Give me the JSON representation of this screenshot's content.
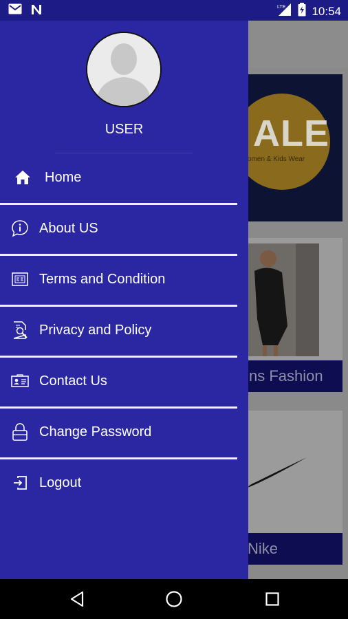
{
  "status_bar": {
    "time": "10:54",
    "network": "LTE",
    "icons": [
      "gmail-icon",
      "n-app-icon",
      "lte-signal-icon",
      "battery-icon"
    ]
  },
  "drawer": {
    "user_name": "USER",
    "background_color": "#2b27a3",
    "items": [
      {
        "label": "Home",
        "icon": "home-icon"
      },
      {
        "label": "About US",
        "icon": "info-icon"
      },
      {
        "label": "Terms and Condition",
        "icon": "document-icon"
      },
      {
        "label": "Privacy and Policy",
        "icon": "search-document-icon"
      },
      {
        "label": "Contact Us",
        "icon": "contact-card-icon"
      },
      {
        "label": "Change Password",
        "icon": "lock-icon"
      },
      {
        "label": "Logout",
        "icon": "logout-icon"
      }
    ]
  },
  "background": {
    "banner_text": "ALE",
    "banner_sub": "omen & Kids Wear",
    "card2_label": "ns Fashion",
    "card3_label": "Nike"
  },
  "nav_bar": {
    "icons": [
      "back-icon",
      "home-circle-icon",
      "recents-icon"
    ]
  }
}
